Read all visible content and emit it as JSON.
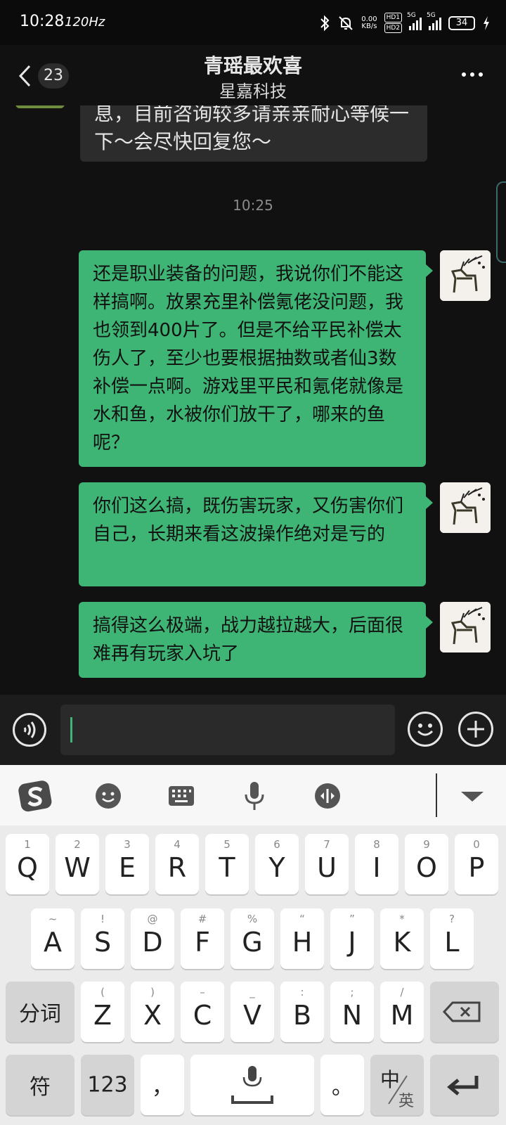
{
  "status_bar": {
    "time": "10:28",
    "refresh": "120Hz",
    "speed_top": "0.00",
    "speed_bottom": "KB/s",
    "hd1": "HD1",
    "hd2": "HD2",
    "net1": "5G",
    "net2": "5G",
    "battery": "34"
  },
  "header": {
    "unread_count": "23",
    "title": "青瑶最欢喜",
    "subtitle": "星嘉科技"
  },
  "chat": {
    "incoming_partial": "息，目前咨询较多请亲亲耐心等候一下～会尽快回复您～",
    "time_separator": "10:25",
    "messages": [
      "还是职业装备的问题，我说你们不能这样搞啊。放累充里补偿氪佬没问题，我也领到400片了。但是不给平民补偿太伤人了，至少也要根据抽数或者仙3数补偿一点啊。游戏里平民和氪佬就像是水和鱼，水被你们放干了，哪来的鱼呢？",
      "你们这么搞，既伤害玩家，又伤害你们自己，长期来看这波操作绝对是亏的",
      "搞得这么极端，战力越拉越大，后面很难再有玩家入坑了"
    ]
  },
  "keyboard": {
    "row1": [
      {
        "sub": "1",
        "key": "Q"
      },
      {
        "sub": "2",
        "key": "W"
      },
      {
        "sub": "3",
        "key": "E"
      },
      {
        "sub": "4",
        "key": "R"
      },
      {
        "sub": "5",
        "key": "T"
      },
      {
        "sub": "6",
        "key": "Y"
      },
      {
        "sub": "7",
        "key": "U"
      },
      {
        "sub": "8",
        "key": "I"
      },
      {
        "sub": "9",
        "key": "O"
      },
      {
        "sub": "0",
        "key": "P"
      }
    ],
    "row2": [
      {
        "sub": "~",
        "key": "A"
      },
      {
        "sub": "!",
        "key": "S"
      },
      {
        "sub": "@",
        "key": "D"
      },
      {
        "sub": "#",
        "key": "F"
      },
      {
        "sub": "%",
        "key": "G"
      },
      {
        "sub": "“",
        "key": "H"
      },
      {
        "sub": "”",
        "key": "J"
      },
      {
        "sub": "*",
        "key": "K"
      },
      {
        "sub": "?",
        "key": "L"
      }
    ],
    "row3": [
      {
        "sub": "(",
        "key": "Z"
      },
      {
        "sub": ")",
        "key": "X"
      },
      {
        "sub": "–",
        "key": "C"
      },
      {
        "sub": "_",
        "key": "V"
      },
      {
        "sub": ":",
        "key": "B"
      },
      {
        "sub": ";",
        "key": "N"
      },
      {
        "sub": "/",
        "key": "M"
      }
    ],
    "segment_label": "分词",
    "symbol_label": "符",
    "number_label": "123",
    "comma_label": "，",
    "period_label": "。",
    "lang_top": "中",
    "lang_bottom": "英",
    "accent_color": "#3eb575"
  }
}
